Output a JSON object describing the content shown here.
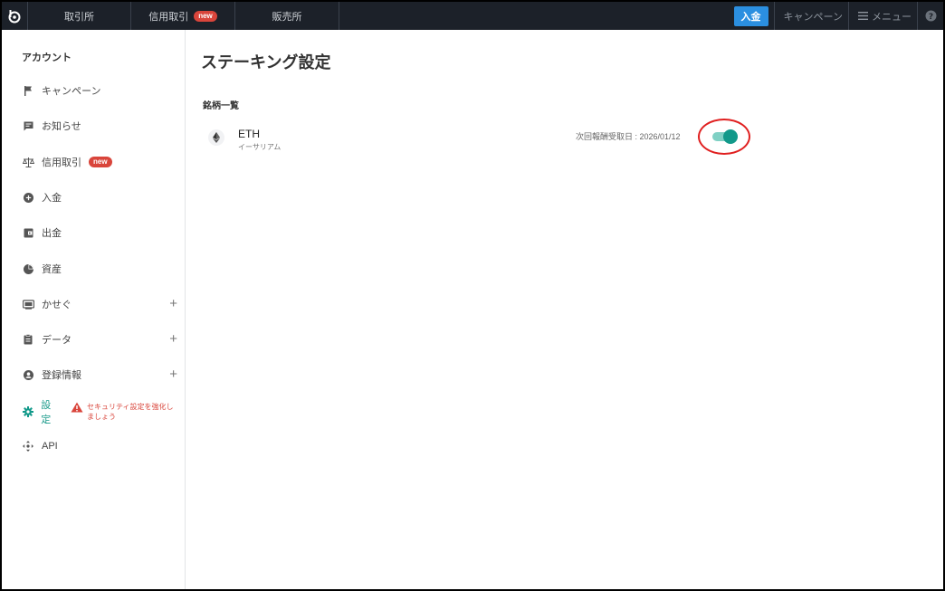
{
  "topbar": {
    "tabs": [
      {
        "label": "取引所"
      },
      {
        "label": "信用取引",
        "badge": "new"
      },
      {
        "label": "販売所"
      }
    ],
    "deposit_label": "入金",
    "campaign_label": "キャンペーン",
    "menu_label": "メニュー",
    "help_icon": "question-circle-icon"
  },
  "sidebar": {
    "title": "アカウント",
    "items": [
      {
        "label": "キャンペーン",
        "icon": "flag-icon"
      },
      {
        "label": "お知らせ",
        "icon": "message-icon"
      },
      {
        "label": "信用取引",
        "icon": "scale-icon",
        "badge": "new"
      },
      {
        "label": "入金",
        "icon": "plus-circle-icon"
      },
      {
        "label": "出金",
        "icon": "wallet-icon"
      },
      {
        "label": "資産",
        "icon": "pie-chart-icon"
      },
      {
        "label": "かせぐ",
        "icon": "earn-icon",
        "expandable": true
      },
      {
        "label": "データ",
        "icon": "clipboard-icon",
        "expandable": true
      },
      {
        "label": "登録情報",
        "icon": "user-circle-icon",
        "expandable": true
      },
      {
        "label": "設定",
        "icon": "gear-icon",
        "active": true,
        "warning": "セキュリティ設定を強化しましょう"
      },
      {
        "label": "API",
        "icon": "api-icon"
      }
    ]
  },
  "main": {
    "title": "ステーキング設定",
    "section_label": "銘柄一覧",
    "coins": [
      {
        "symbol": "ETH",
        "name": "イーサリアム",
        "next_reward": "次回報酬受取日 : 2026/01/12",
        "enabled": true
      }
    ]
  },
  "colors": {
    "topbar_bg": "#1c2129",
    "accent_teal": "#12998a",
    "deposit_blue": "#2b8fe0",
    "badge_red": "#d9453b",
    "highlight_red": "#e02020"
  }
}
